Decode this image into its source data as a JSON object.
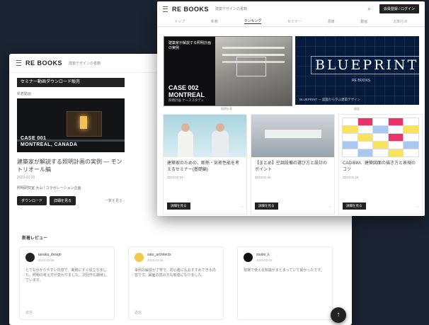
{
  "back": {
    "logo": "RE BOOKS",
    "logo_sub": "建築デザインの書籍",
    "banner": "セミナー動画ダウンロード販売",
    "label": "新着動画",
    "thumb_overlay": "CASE 001\nMONTREAL, CANADA",
    "title": "建築家が解説する照明計画の実例 — モントリオール編",
    "meta": "2023.02.10",
    "author": "照明研究室 大山 / コラボレーション企画",
    "btn1": "ダウンロード",
    "btn2": "詳細を見る",
    "more": "一覧を見る ›",
    "section": "新着レビュー",
    "reviews": [
      {
        "name": "tanaka_design",
        "date": "2023.02.08",
        "text": "とても分かりやすい内容で、実務にすぐ役立ちました。照明の考え方が変わりました。次回作も期待しています。",
        "footer": "返信"
      },
      {
        "name": "sato_architects",
        "date": "2023.02.06",
        "text": "事例の解説が丁寧で、初心者にもおすすめできる内容です。図面の読み方も勉強になりました。",
        "footer": "返信"
      },
      {
        "name": "studio_k",
        "date": "2023.02.03",
        "text": "現場で使える知識がまとまっていて良かったです。",
        "footer": ""
      }
    ],
    "fab_icon": "arrow-up-icon",
    "fab_glyph": "↑"
  },
  "front": {
    "logo": "RE BOOKS",
    "logo_sub": "建築デザインの書籍",
    "search_glyph": "⌕",
    "login": "会員登録 / ログイン",
    "tabs": [
      "トップ",
      "新着",
      "ランキング",
      "セミナー",
      "書籍",
      "動画",
      "お知らせ"
    ],
    "active_tab": 2,
    "hero1": {
      "overlay": "建築家が解説する照明計画の実例",
      "case": "CASE 002\nMONTREAL",
      "caption": "照明計画 ケーススタディ"
    },
    "hero2": {
      "word": "BLUEPRINT",
      "sub": "RE BOOKS",
      "caption": "BLUEPRINT — 図面から学ぶ建築デザイン"
    },
    "hero1_caption": "照明計画",
    "hero2_caption": "図面",
    "cards": [
      {
        "title": "建築家のための、断熱・気密性能を考えるセミナー(基礎編)",
        "date": "2023.02.01",
        "button": "詳細を見る",
        "more": "›"
      },
      {
        "title": "【まとめ】空調設備の選び方と設計のポイント",
        "date": "2023.01.25",
        "button": "詳細を見る",
        "more": "›"
      },
      {
        "title": "CAD/BIM、建築図面の描き方と表現のコツ",
        "date": "2023.01.18",
        "button": "詳細を見る",
        "more": "›"
      }
    ]
  },
  "colors": {
    "bg": "#1b2433",
    "accent_pink": "#e8336b",
    "blueprint": "#061a3c"
  }
}
